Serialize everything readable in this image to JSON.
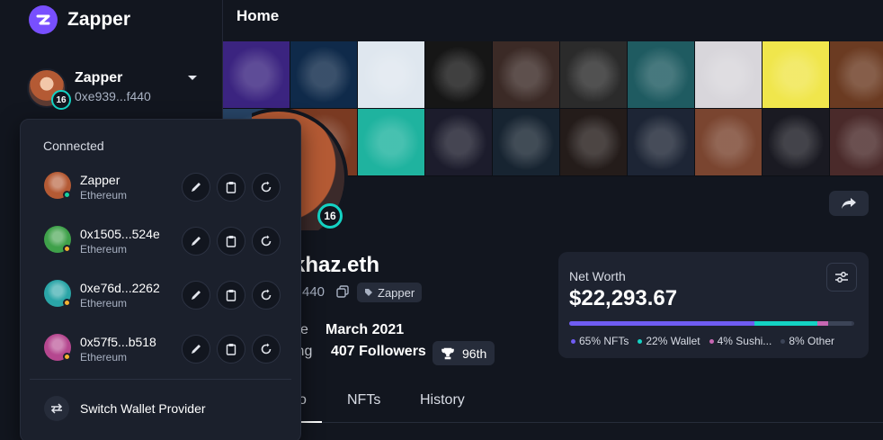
{
  "sidebar": {
    "brand": "Zapper",
    "account": {
      "name": "Zapper",
      "address": "0xe939...f440",
      "level": "16"
    }
  },
  "dropdown": {
    "title": "Connected",
    "wallets": [
      {
        "name": "Zapper",
        "network": "Ethereum",
        "avatar_color": "#b45a34",
        "status_color": "#14d3a0"
      },
      {
        "name": "0x1505...524e",
        "network": "Ethereum",
        "avatar_color": "#3fa14a",
        "status_color": "#f5b131"
      },
      {
        "name": "0xe76d...2262",
        "network": "Ethereum",
        "avatar_color": "#2aa5a7",
        "status_color": "#f5b131"
      },
      {
        "name": "0x57f5...b518",
        "network": "Ethereum",
        "avatar_color": "#b5478f",
        "status_color": "#f5b131"
      }
    ],
    "actions": [
      "pencil-icon",
      "clipboard-icon",
      "refresh-icon"
    ],
    "switch_label": "Switch Wallet Provider"
  },
  "header": {
    "title": "Home"
  },
  "gallery": {
    "tiles": [
      "#3b2480",
      "#0f2a4a",
      "#dfe7ef",
      "#161616",
      "#3b2a26",
      "#2b2b2b",
      "#1f5b61",
      "#d8d6db",
      "#f0e64c",
      "#6b3b22",
      "#274466",
      "#7a3a22",
      "#1fb39f",
      "#1c1c2c",
      "#172431",
      "#241c1a",
      "#1d2535",
      "#7a4530",
      "#1a1a22",
      "#4a2a2a"
    ]
  },
  "profile": {
    "level": "16",
    "handle": "khaz.eth",
    "address_tail": "440",
    "tag": "Zapper",
    "since_label": "ce",
    "since_value": "March 2021",
    "following_label": "ing",
    "followers": "407 Followers",
    "rank": "96th"
  },
  "networth": {
    "label": "Net Worth",
    "value": "$22,293.67",
    "legend": [
      {
        "label": "65% NFTs",
        "color": "#6f5cf2",
        "pct": 65
      },
      {
        "label": "22% Wallet",
        "color": "#14d3c4",
        "pct": 22
      },
      {
        "label": "4% Sushi...",
        "color": "#c767b3",
        "pct": 4
      },
      {
        "label": "8% Other",
        "color": "#3c4457",
        "pct": 8
      }
    ]
  },
  "tabs": [
    "o",
    "NFTs",
    "History"
  ]
}
